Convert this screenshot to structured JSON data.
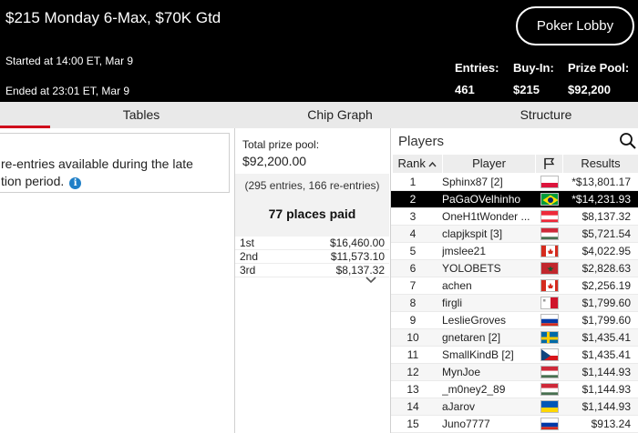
{
  "header": {
    "title": "$215 Monday 6-Max, $70K Gtd",
    "started": "Started at 14:00 ET, Mar 9",
    "ended": "Ended at 23:01 ET, Mar 9",
    "lobby_button": "Poker Lobby",
    "stats": [
      {
        "label": "Entries:",
        "value": "461"
      },
      {
        "label": "Buy-In:",
        "value": "$215"
      },
      {
        "label": "Prize Pool:",
        "value": "$92,200"
      }
    ]
  },
  "tabs": [
    "Tables",
    "Chip Graph",
    "Structure"
  ],
  "info": {
    "line1": "re-entries available during the late",
    "line2": "tion period."
  },
  "prize": {
    "label": "Total prize pool:",
    "amount": "$92,200.00",
    "entries_text": "(295 entries, 166 re-entries)",
    "places_paid": "77 places paid",
    "payouts": [
      {
        "place": "1st",
        "amount": "$16,460.00"
      },
      {
        "place": "2nd",
        "amount": "$11,573.10"
      },
      {
        "place": "3rd",
        "amount": "$8,137.32"
      }
    ]
  },
  "players": {
    "title": "Players",
    "columns": {
      "rank": "Rank",
      "player": "Player",
      "results": "Results"
    },
    "rows": [
      {
        "rank": "1",
        "name": "Sphinx87 [2]",
        "flag": "poland-flag",
        "result": "*$13,801.17"
      },
      {
        "rank": "2",
        "name": "PaGaOVelhinho",
        "flag": "brazil-flag",
        "result": "*$14,231.93"
      },
      {
        "rank": "3",
        "name": "OneH1tWonder ...",
        "flag": "austria-flag",
        "result": "$8,137.32"
      },
      {
        "rank": "4",
        "name": "clapjkspit [3]",
        "flag": "hungary-flag",
        "result": "$5,721.54"
      },
      {
        "rank": "5",
        "name": "jmslee21",
        "flag": "canada-flag",
        "result": "$4,022.95"
      },
      {
        "rank": "6",
        "name": "YOLOBETS",
        "flag": "morocco-flag",
        "result": "$2,828.63"
      },
      {
        "rank": "7",
        "name": "achen",
        "flag": "canada-flag",
        "result": "$2,256.19"
      },
      {
        "rank": "8",
        "name": "firgli",
        "flag": "malta-flag",
        "result": "$1,799.60"
      },
      {
        "rank": "9",
        "name": "LeslieGroves",
        "flag": "russia-flag",
        "result": "$1,799.60"
      },
      {
        "rank": "10",
        "name": "gnetaren [2]",
        "flag": "sweden-flag",
        "result": "$1,435.41"
      },
      {
        "rank": "11",
        "name": "SmallKindB [2]",
        "flag": "czechia-flag",
        "result": "$1,435.41"
      },
      {
        "rank": "12",
        "name": "MynJoe",
        "flag": "hungary-flag",
        "result": "$1,144.93"
      },
      {
        "rank": "13",
        "name": "_m0ney2_89",
        "flag": "hungary-flag",
        "result": "$1,144.93"
      },
      {
        "rank": "14",
        "name": "aJarov",
        "flag": "ukraine-flag",
        "result": "$1,144.93"
      },
      {
        "rank": "15",
        "name": "Juno7777",
        "flag": "russia-flag",
        "result": "$913.24"
      }
    ]
  },
  "colors": {
    "accent": "#d0021b",
    "header_bg": "#000000",
    "info_icon": "#1f7fc7"
  }
}
